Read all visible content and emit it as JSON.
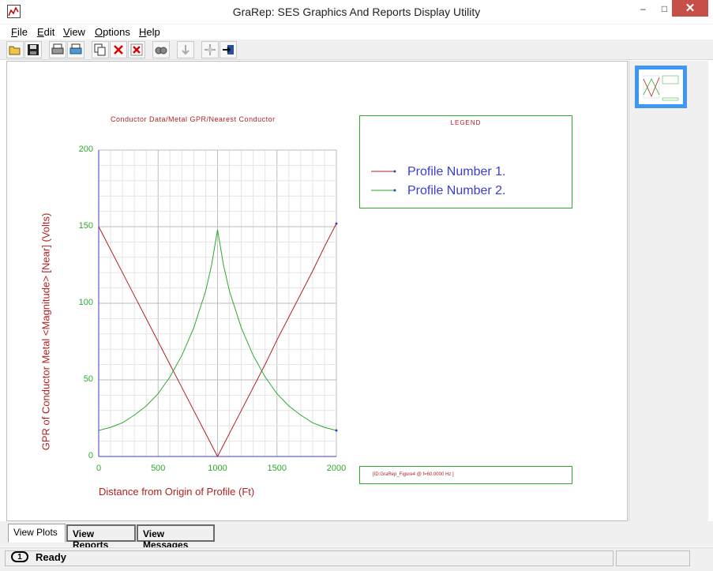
{
  "window": {
    "title": "GraRep: SES Graphics And Reports Display Utility",
    "min_symbol": "–",
    "max_symbol": "□",
    "close_symbol": "✕"
  },
  "menu": [
    {
      "label": "File",
      "u": "F",
      "rest": "ile"
    },
    {
      "label": "Edit",
      "u": "E",
      "rest": "dit"
    },
    {
      "label": "View",
      "u": "V",
      "rest": "iew"
    },
    {
      "label": "Options",
      "u": "O",
      "rest": "ptions"
    },
    {
      "label": "Help",
      "u": "H",
      "rest": "elp"
    }
  ],
  "toolbar": {
    "icons": [
      "open-folder-icon",
      "save-icon",
      "print-icon",
      "print-preview-icon",
      "copy-icon",
      "delete-icon",
      "delete-all-icon",
      "find-icon",
      "down-arrow-icon",
      "move-icon",
      "export-icon"
    ]
  },
  "chart_data": {
    "type": "line",
    "title": "Conductor Data/Metal GPR/Nearest Conductor",
    "xlabel": "Distance from Origin of Profile (Ft)",
    "ylabel": "GPR of Conductor Metal <Magnitude> [Near] (Volts)",
    "xlim": [
      0,
      2000
    ],
    "ylim": [
      0,
      200
    ],
    "xticks": [
      "0",
      "500",
      "1000",
      "1500",
      "2000"
    ],
    "yticks": [
      "0",
      "50",
      "100",
      "150",
      "200"
    ],
    "grid": true,
    "series": [
      {
        "name": "Profile Number  1.",
        "color": "#b22222",
        "x": [
          0,
          100,
          200,
          300,
          400,
          500,
          600,
          700,
          800,
          900,
          1000,
          1100,
          1200,
          1300,
          1400,
          1500,
          1600,
          1700,
          1800,
          1900,
          2000
        ],
        "y": [
          150,
          135,
          120,
          105,
          90,
          75,
          60,
          45,
          30,
          15,
          0,
          15,
          30,
          45,
          60,
          76,
          91,
          106,
          121,
          137,
          152
        ]
      },
      {
        "name": "Profile Number  2.",
        "color": "#2eaa2e",
        "x": [
          0,
          100,
          200,
          300,
          400,
          500,
          600,
          700,
          800,
          900,
          950,
          1000,
          1050,
          1100,
          1200,
          1300,
          1400,
          1500,
          1600,
          1700,
          1800,
          1900,
          2000
        ],
        "y": [
          17,
          19,
          22,
          27,
          33,
          41,
          52,
          66,
          84,
          108,
          125,
          148,
          125,
          108,
          84,
          66,
          52,
          41,
          33,
          27,
          22,
          19,
          17
        ]
      }
    ],
    "legend": {
      "title": "LEGEND",
      "placement": "right"
    },
    "footer": "[ID:GraRep_Figure4 @ f=60.0000 Hz ]"
  },
  "tabs": [
    {
      "label": "View Plots",
      "active": true
    },
    {
      "label": "View Reports",
      "active": false
    },
    {
      "label": "View Messages",
      "active": false
    }
  ],
  "status": {
    "text": "Ready",
    "icon_number": "1"
  }
}
